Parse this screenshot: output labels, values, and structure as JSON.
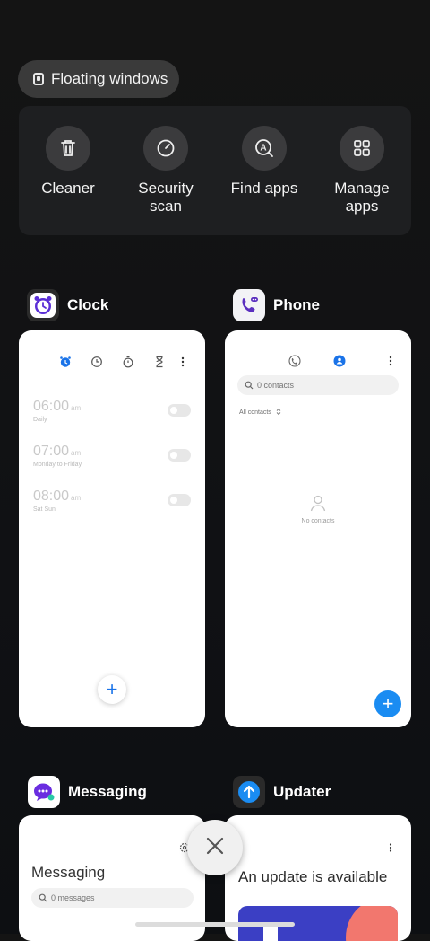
{
  "floating_windows": {
    "label": "Floating windows"
  },
  "tools": [
    {
      "label": "Cleaner",
      "icon": "trash-icon"
    },
    {
      "label": "Security scan",
      "icon": "security-scan-icon"
    },
    {
      "label": "Find apps",
      "icon": "find-apps-icon"
    },
    {
      "label": "Manage apps",
      "icon": "manage-apps-icon"
    }
  ],
  "apps": {
    "clock": {
      "title": "Clock",
      "alarms": [
        {
          "time": "06:00",
          "ampm": "am",
          "repeat": "Daily"
        },
        {
          "time": "07:00",
          "ampm": "am",
          "repeat": "Monday to Friday"
        },
        {
          "time": "08:00",
          "ampm": "am",
          "repeat": "Sat Sun"
        }
      ],
      "fab": "+"
    },
    "phone": {
      "title": "Phone",
      "search_placeholder": "0 contacts",
      "filter_label": "All contacts",
      "empty_text": "No contacts",
      "fab": "+"
    },
    "messaging": {
      "title": "Messaging",
      "header": "Messaging",
      "search_placeholder": "0 messages"
    },
    "updater": {
      "title": "Updater",
      "headline": "An update is available"
    }
  },
  "colors": {
    "accent": "#1a73e8",
    "phone_icon": "#5b2fbf",
    "messaging_icon": "#6a2de0",
    "updater_icon": "#1a8cf2"
  }
}
